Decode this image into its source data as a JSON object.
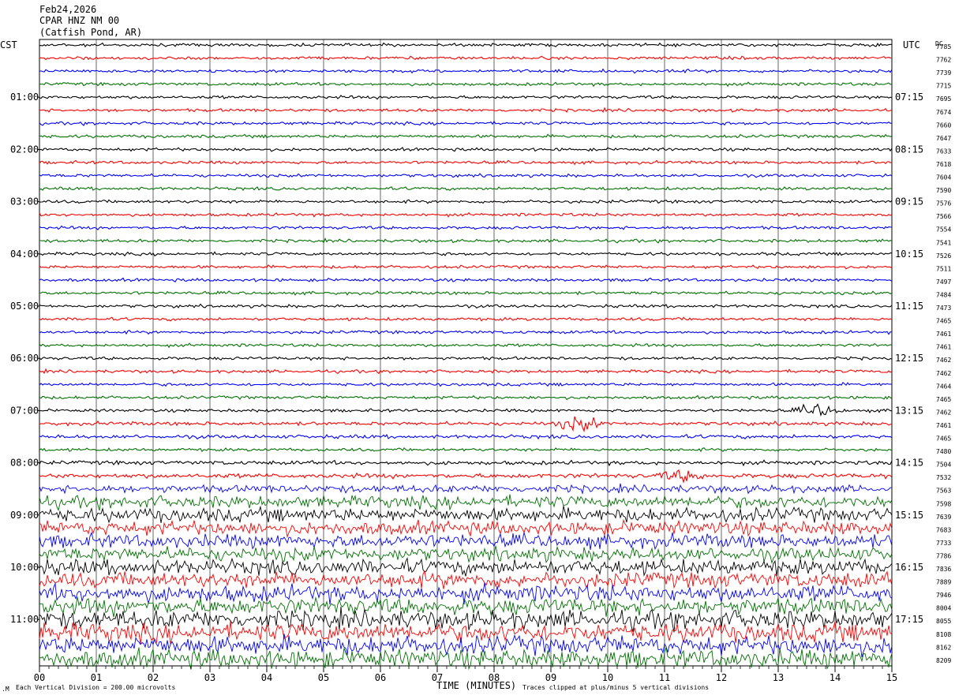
{
  "header": {
    "date": "Feb24,2026",
    "station": "CPAR HNZ NM 00",
    "location": "(Catfish Pond, AR)"
  },
  "left_axis": {
    "title": "CST",
    "labels": [
      "01:00",
      "02:00",
      "03:00",
      "04:00",
      "05:00",
      "06:00",
      "07:00",
      "08:00",
      "09:00",
      "10:00",
      "11:00"
    ]
  },
  "right_axis": {
    "title": "UTC",
    "labels": [
      "07:15",
      "08:15",
      "09:15",
      "10:15",
      "11:15",
      "12:15",
      "13:15",
      "14:15",
      "15:15",
      "16:15",
      "17:15"
    ]
  },
  "dc_axis": {
    "title": "DC",
    "values": [
      "7785",
      "7762",
      "7739",
      "7715",
      "7695",
      "7674",
      "7660",
      "7647",
      "7633",
      "7618",
      "7604",
      "7590",
      "7576",
      "7566",
      "7554",
      "7541",
      "7526",
      "7511",
      "7497",
      "7484",
      "7473",
      "7465",
      "7461",
      "7461",
      "7462",
      "7462",
      "7464",
      "7465",
      "7462",
      "7461",
      "7465",
      "7480",
      "7504",
      "7532",
      "7563",
      "7598",
      "7639",
      "7683",
      "7733",
      "7786",
      "7836",
      "7889",
      "7946",
      "8004",
      "8055",
      "8108",
      "8162",
      "8209"
    ]
  },
  "footer": {
    "scale_note": "Each Vertical Division =  200.00 microvolts",
    "xlabel": "TIME (MINUTES)",
    "clip_note": "Traces clipped at plus/minus 5 vertical divisions"
  },
  "colors": {
    "trace_cycle": [
      "#000000",
      "#ff0000",
      "#0000ff",
      "#007000"
    ],
    "grid": "#000000"
  },
  "chart_data": {
    "type": "line",
    "xlabel": "TIME (MINUTES)",
    "ylabel": "",
    "x_ticks": [
      "00",
      "01",
      "02",
      "03",
      "04",
      "05",
      "06",
      "07",
      "08",
      "09",
      "10",
      "11",
      "12",
      "13",
      "14",
      "15"
    ],
    "xlim": [
      0,
      15
    ],
    "rows": 48,
    "minutes_per_row": 15,
    "vertical_division_microvolts": 200.0,
    "clip_divisions": 5,
    "grid": true,
    "row_noise_level": [
      1,
      1,
      1,
      1,
      1,
      1,
      1,
      1,
      1,
      1,
      1,
      1,
      1,
      1,
      1,
      1,
      1,
      1,
      1,
      1,
      1,
      1,
      1,
      1,
      1,
      1,
      1,
      1,
      1,
      1.2,
      1.2,
      1,
      1.3,
      1.5,
      2.5,
      4,
      4.5,
      4.5,
      4.5,
      4.5,
      5,
      5,
      5.5,
      5.5,
      6,
      6,
      6,
      6
    ],
    "events": [
      {
        "row": 28,
        "minute": 13.7,
        "amplitude": 2.5
      },
      {
        "row": 29,
        "minute": 9.5,
        "amplitude": 3
      },
      {
        "row": 33,
        "minute": 11.3,
        "amplitude": 2
      }
    ]
  }
}
